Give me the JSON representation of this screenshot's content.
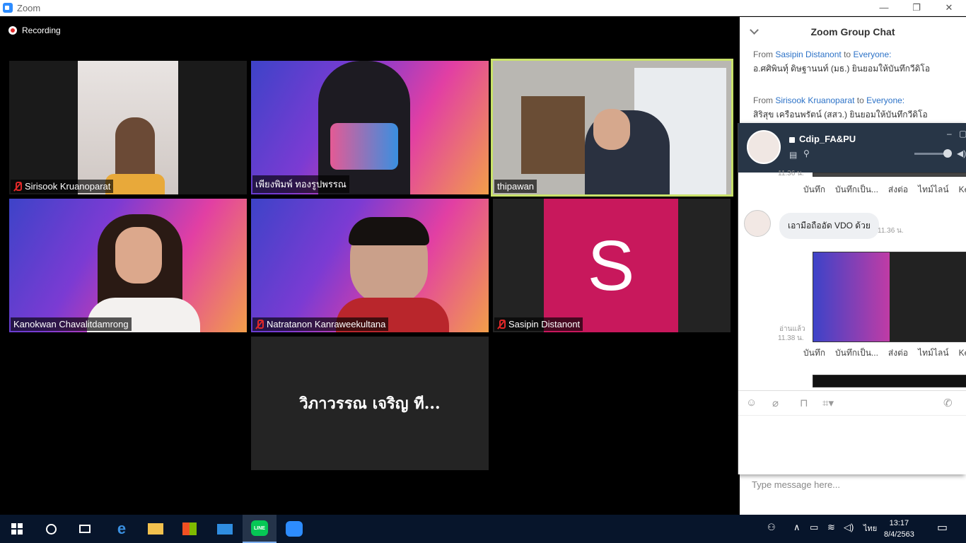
{
  "window": {
    "title": "Zoom",
    "minimize": "—",
    "restore": "❐",
    "close": "✕"
  },
  "recording": "Recording",
  "participants": [
    {
      "name": "Sirisook Kruanoparat",
      "muted": true
    },
    {
      "name": "เพียงพิมพ์ ทองรูปพรรณ",
      "muted": false
    },
    {
      "name": "thipawan",
      "muted": false
    },
    {
      "name": "Kanokwan Chavalitdamrong",
      "muted": false
    },
    {
      "name": "Natratanon Kanraweekultana",
      "muted": true
    },
    {
      "name": "Sasipin Distanont",
      "muted": true,
      "initial": "S"
    },
    {
      "name": "วิภาวรรณ เจริญ ที...",
      "muted": false
    }
  ],
  "chat": {
    "title": "Zoom Group Chat",
    "messages": [
      {
        "from_label": "From",
        "sender": "Sasipin Distanont",
        "to_label": "to",
        "target": "Everyone:",
        "text": "อ.ศศิพินทุ์ ดิษฐานนท์ (มธ.) ยินยอมให้บันทึกวีดิโอ"
      },
      {
        "from_label": "From",
        "sender": "Sirisook Kruanoparat",
        "to_label": "to",
        "target": "Everyone:",
        "text": "สิริสุข เครือนพรัตน์ (สสว.) ยินยอมให้บันทึกวีดิโอ"
      }
    ],
    "input_placeholder": "Type message here..."
  },
  "line_chat": {
    "title": "Cdip_FA&PU",
    "time_top": "11.36 น.",
    "actions": [
      "บันทึก",
      "บันทึกเป็น...",
      "ส่งต่อ",
      "ไทม์ไลน์",
      "Kee"
    ],
    "bubble_text": "เอามือถืออัด VDO ด้วย",
    "bubble_time": "11.36 น.",
    "read_label": "อ่านแล้ว",
    "read_time": "11.38 น."
  },
  "taskbar": {
    "time": "13:17",
    "date": "8/4/2563",
    "lang": "ไทย"
  },
  "colors": {
    "accent": "#2d8cff",
    "active_border": "#c9e26a",
    "avatar_bg": "#c8185c",
    "link": "#2c72c7",
    "taskbar": "#07152b"
  }
}
